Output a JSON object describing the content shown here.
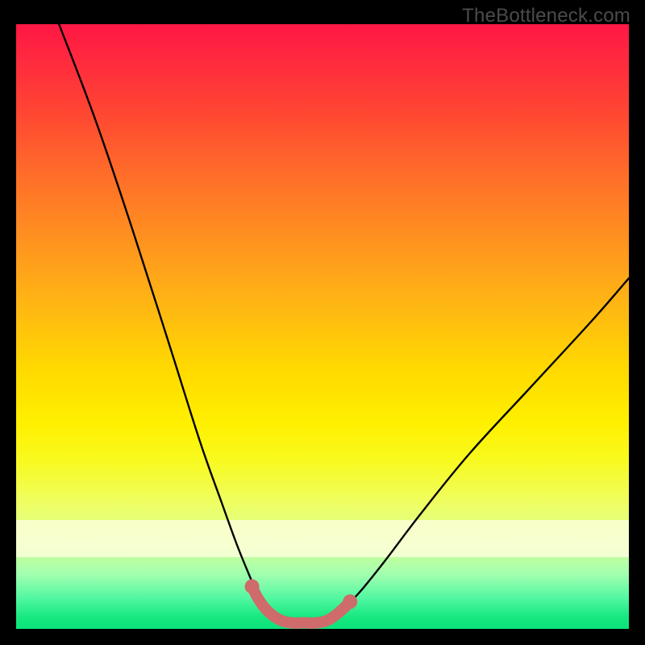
{
  "watermark": "TheBottleneck.com",
  "chart_data": {
    "type": "line",
    "title": "",
    "xlabel": "",
    "ylabel": "",
    "xlim": [
      0,
      100
    ],
    "ylim": [
      0,
      100
    ],
    "grid": false,
    "legend": false,
    "annotations": [],
    "background_gradient": {
      "top": "#ff1744",
      "mid": "#ffd900",
      "bottom": "#0be37a"
    },
    "series": [
      {
        "name": "bottleneck-curve",
        "color": "#000000",
        "x": [
          7,
          13,
          19,
          25,
          30,
          33.5,
          36,
          38,
          39.5,
          41,
          43,
          45,
          47,
          49,
          51,
          53,
          56,
          60,
          66,
          74,
          84,
          94,
          100
        ],
        "y": [
          100,
          84,
          66,
          47,
          31,
          21,
          14,
          9,
          5.5,
          3,
          1.5,
          1,
          1,
          1,
          1.5,
          3,
          6,
          11,
          19,
          29,
          40,
          51,
          58
        ]
      },
      {
        "name": "trough-highlight",
        "color": "#cf6b6b",
        "stroke_width": 9,
        "x": [
          38.5,
          39.5,
          41,
          43,
          45,
          47,
          49,
          51,
          53,
          54.5
        ],
        "y": [
          7,
          5,
          3,
          1.5,
          1,
          1,
          1,
          1.5,
          3,
          4.5
        ]
      }
    ],
    "markers": [
      {
        "name": "trough-dot-left",
        "x": 38.5,
        "y": 7,
        "r": 6,
        "color": "#cf6b6b"
      },
      {
        "name": "trough-dot-right",
        "x": 54.5,
        "y": 4.5,
        "r": 6,
        "color": "#cf6b6b"
      }
    ]
  }
}
